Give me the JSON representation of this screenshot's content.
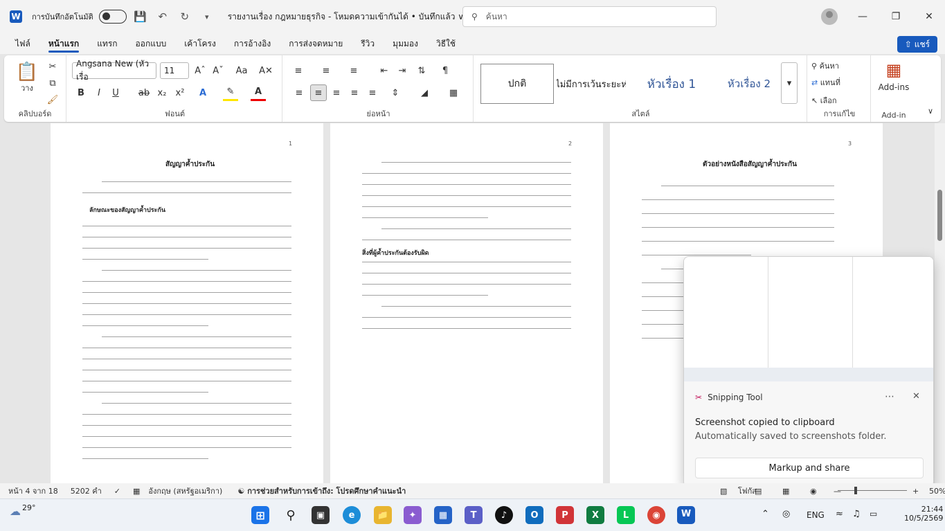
{
  "titlebar": {
    "app_icon": "word-icon",
    "autosave_label": "การบันทึกอัตโนมัติ",
    "doc_title": "รายงานเรื่อง กฎหมายธุรกิจ - โหมดความเข้ากันได้ • บันทึกแล้ว ∨",
    "search_placeholder": "ค้นหา"
  },
  "tabs": [
    "ไฟล์",
    "หน้าแรก",
    "แทรก",
    "ออกแบบ",
    "เค้าโครง",
    "การอ้างอิง",
    "การส่งจดหมาย",
    "รีวิว",
    "มุมมอง",
    "วิธีใช้"
  ],
  "share_label": "แชร์",
  "ribbon": {
    "clipboard": {
      "paste": "วาง",
      "label": "คลิปบอร์ด"
    },
    "font": {
      "name": "Angsana New (หัวเรื่อ",
      "size": "11",
      "label": "ฟอนต์"
    },
    "paragraph": {
      "label": "ย่อหน้า"
    },
    "styles": {
      "items": [
        "ปกติ",
        "ไม่มีการเว้นระยะห่",
        "หัวเรื่อง 1",
        "หัวเรื่อง 2"
      ],
      "label": "สไตล์"
    },
    "editing": {
      "find": "ค้นหา",
      "replace": "แทนที่",
      "select": "เลือก",
      "label": "การแก้ไข"
    },
    "addins": {
      "button": "Add-ins",
      "label": "Add-in"
    }
  },
  "pages": [
    {
      "num": "1",
      "title": "สัญญาค้ำประกัน",
      "section": "ลักษณะของสัญญาค้ำประกัน"
    },
    {
      "num": "2",
      "section": "สิ่งที่ผู้ค้ำประกันต้องรับผิด"
    },
    {
      "num": "3",
      "title": "ตัวอย่างหนังสือสัญญาค้ำประกัน"
    }
  ],
  "statusbar": {
    "page": "หน้า 4 จาก 18",
    "words": "5202 คำ",
    "language": "อังกฤษ (สหรัฐอเมริกา)",
    "accessibility": "การช่วยสำหรับการเข้าถึง: โปรดศึกษาคำแนะนำ",
    "focus": "โฟกัส",
    "zoom": "50%"
  },
  "toast": {
    "app": "Snipping Tool",
    "heading": "Screenshot copied to clipboard",
    "body": "Automatically saved to screenshots folder.",
    "action": "Markup and share"
  },
  "taskbar": {
    "weather": "29°",
    "lang": "ENG",
    "time": "21:44",
    "date": "10/5/2569"
  }
}
